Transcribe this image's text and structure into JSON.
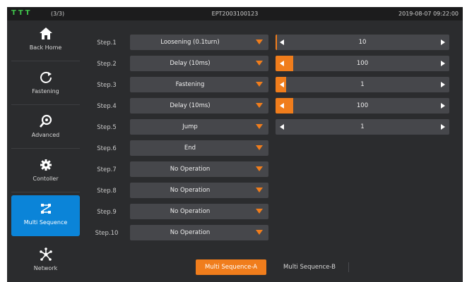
{
  "status_bar": {
    "icons": [
      "tool-icon",
      "tool-icon",
      "tool-icon"
    ],
    "count": "(3/3)",
    "device_id": "EPT2003100123",
    "datetime": "2019-08-07 09:22:00",
    "icon_color": "#3fc14a"
  },
  "sidebar": {
    "items": [
      {
        "label": "Back Home",
        "icon": "home-icon",
        "active": false
      },
      {
        "label": "Fastening",
        "icon": "rotate-icon",
        "active": false
      },
      {
        "label": "Advanced",
        "icon": "magnifier-icon",
        "active": false
      },
      {
        "label": "Contoller",
        "icon": "gear-icon",
        "active": false
      },
      {
        "label": "Multi Sequence",
        "icon": "sequence-icon",
        "active": true
      },
      {
        "label": "Network",
        "icon": "network-icon",
        "active": false
      }
    ],
    "active_color": "#0b84d8"
  },
  "steps": [
    {
      "label": "Step.1",
      "operation": "Loosening (0.1turn)",
      "param": {
        "value": "10",
        "fill": 0.0
      }
    },
    {
      "label": "Step.2",
      "operation": "Delay (10ms)",
      "param": {
        "value": "100",
        "fill": 0.1
      }
    },
    {
      "label": "Step.3",
      "operation": "Fastening",
      "param": {
        "value": "1",
        "fill": 0.06
      }
    },
    {
      "label": "Step.4",
      "operation": "Delay (10ms)",
      "param": {
        "value": "100",
        "fill": 0.1
      }
    },
    {
      "label": "Step.5",
      "operation": "Jump",
      "param": {
        "value": "1",
        "fill": 0.0
      }
    },
    {
      "label": "Step.6",
      "operation": "End"
    },
    {
      "label": "Step.7",
      "operation": "No Operation"
    },
    {
      "label": "Step.8",
      "operation": "No Operation"
    },
    {
      "label": "Step.9",
      "operation": "No Operation"
    },
    {
      "label": "Step.10",
      "operation": "No Operation"
    }
  ],
  "tabs": [
    {
      "label": "Multi Sequence-A",
      "active": true
    },
    {
      "label": "Multi Sequence-B",
      "active": false
    }
  ],
  "accent_color": "#f07d1c"
}
